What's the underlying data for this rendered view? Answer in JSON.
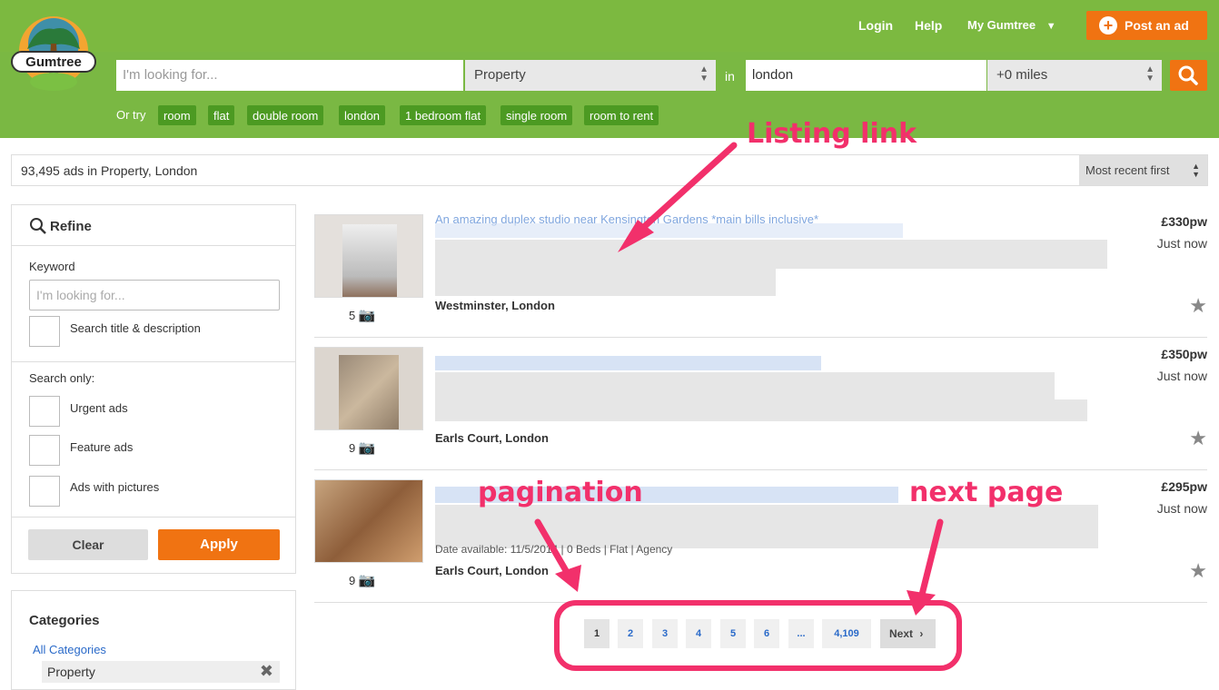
{
  "header": {
    "brand": "Gumtree",
    "nav": {
      "login": "Login",
      "help": "Help",
      "my_gumtree": "My Gumtree"
    },
    "post_ad": "Post an ad",
    "search": {
      "keyword_placeholder": "I'm looking for...",
      "category_value": "Property",
      "in_label": "in",
      "location_value": "london",
      "distance_value": "+0 miles"
    },
    "or_try_label": "Or try",
    "suggestions": [
      "room",
      "flat",
      "double room",
      "london",
      "1 bedroom flat",
      "single room",
      "room to rent"
    ]
  },
  "results": {
    "count_text": "93,495 ads in Property, London",
    "sort_value": "Most recent first"
  },
  "refine": {
    "title": "Refine",
    "keyword_label": "Keyword",
    "keyword_placeholder": "I'm looking for...",
    "search_title_desc": "Search title & description",
    "search_only_label": "Search only:",
    "options": [
      "Urgent ads",
      "Feature ads",
      "Ads with pictures"
    ],
    "clear": "Clear",
    "apply": "Apply"
  },
  "categories": {
    "title": "Categories",
    "all": "All Categories",
    "selected": "Property"
  },
  "listings": [
    {
      "title": "An amazing duplex studio near Kensington Gardens *main bills inclusive*",
      "location": "Westminster, London",
      "price": "£330pw",
      "time": "Just now",
      "photos": "5"
    },
    {
      "title": "",
      "location": "Earls Court, London",
      "price": "£350pw",
      "time": "Just now",
      "photos": "9"
    },
    {
      "title": "",
      "location": "Earls Court, London",
      "price": "£295pw",
      "time": "Just now",
      "photos": "9",
      "meta": "Date available: 11/5/2014  |  0 Beds  |  Flat  |  Agency"
    }
  ],
  "pagination": {
    "pages": [
      "1",
      "2",
      "3",
      "4",
      "5",
      "6",
      "...",
      "4,109"
    ],
    "current": "1",
    "next": "Next"
  },
  "annotations": {
    "listing_link": "Listing link",
    "pagination": "pagination",
    "next_page": "next page"
  },
  "colors": {
    "brand_green": "#7cb940",
    "accent_orange": "#f07312",
    "annotation_pink": "#f2306b",
    "link_blue": "#2a6ac9"
  }
}
